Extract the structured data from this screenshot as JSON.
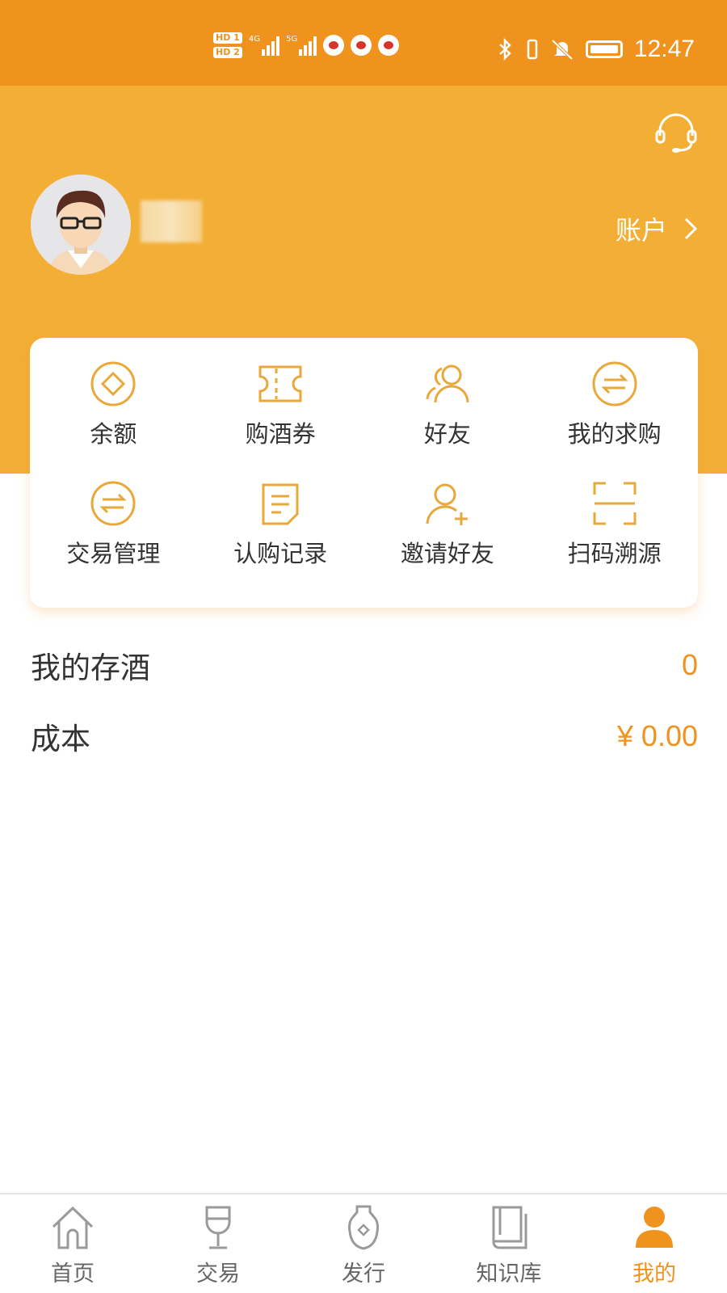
{
  "status_bar": {
    "time": "12:47",
    "sim1": "HD 1",
    "sim2": "HD 2",
    "net1": "4G",
    "net2": "5G"
  },
  "header": {
    "username": "",
    "account_label": "账户"
  },
  "quick_menu": {
    "items": [
      {
        "label": "余额",
        "icon": "balance-diamond-icon"
      },
      {
        "label": "购酒券",
        "icon": "coupon-ticket-icon"
      },
      {
        "label": "好友",
        "icon": "friends-icon"
      },
      {
        "label": "我的求购",
        "icon": "exchange-arrows-icon"
      },
      {
        "label": "交易管理",
        "icon": "exchange-arrows-icon"
      },
      {
        "label": "认购记录",
        "icon": "document-icon"
      },
      {
        "label": "邀请好友",
        "icon": "add-user-icon"
      },
      {
        "label": "扫码溯源",
        "icon": "scan-frame-icon"
      }
    ]
  },
  "stats": {
    "wine_label": "我的存酒",
    "wine_value": "0",
    "cost_label": "成本",
    "cost_value": "¥ 0.00"
  },
  "tabs": [
    {
      "label": "首页",
      "icon": "home-icon",
      "active": false
    },
    {
      "label": "交易",
      "icon": "wine-glass-icon",
      "active": false
    },
    {
      "label": "发行",
      "icon": "liquor-bottle-icon",
      "active": false
    },
    {
      "label": "知识库",
      "icon": "book-icon",
      "active": false
    },
    {
      "label": "我的",
      "icon": "user-icon",
      "active": true
    }
  ],
  "colors": {
    "status_bar": "#f0921e",
    "header": "#f3ae35",
    "accent": "#f0921e",
    "icon": "#e9a83a"
  }
}
